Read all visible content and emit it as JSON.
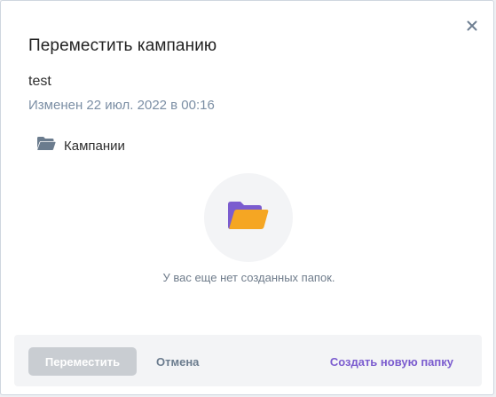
{
  "dialog": {
    "title": "Переместить кампанию",
    "campaign_name": "test",
    "modified": "Изменен 22 июл. 2022 в 00:16"
  },
  "folder_tree": {
    "root_label": "Кампании"
  },
  "empty_state": {
    "message": "У вас еще нет созданных папок."
  },
  "footer": {
    "move_label": "Переместить",
    "cancel_label": "Отмена",
    "create_folder_label": "Создать новую папку"
  },
  "icons": {
    "close": "close-icon",
    "folder": "folder-open-icon",
    "empty": "folder-illustration-icon"
  },
  "colors": {
    "accent": "#7b5ccf",
    "disabled_button": "#c9cdd2",
    "muted_text": "#7b8ea4",
    "folder_orange": "#f5a623",
    "folder_purple": "#7b5ccf"
  }
}
